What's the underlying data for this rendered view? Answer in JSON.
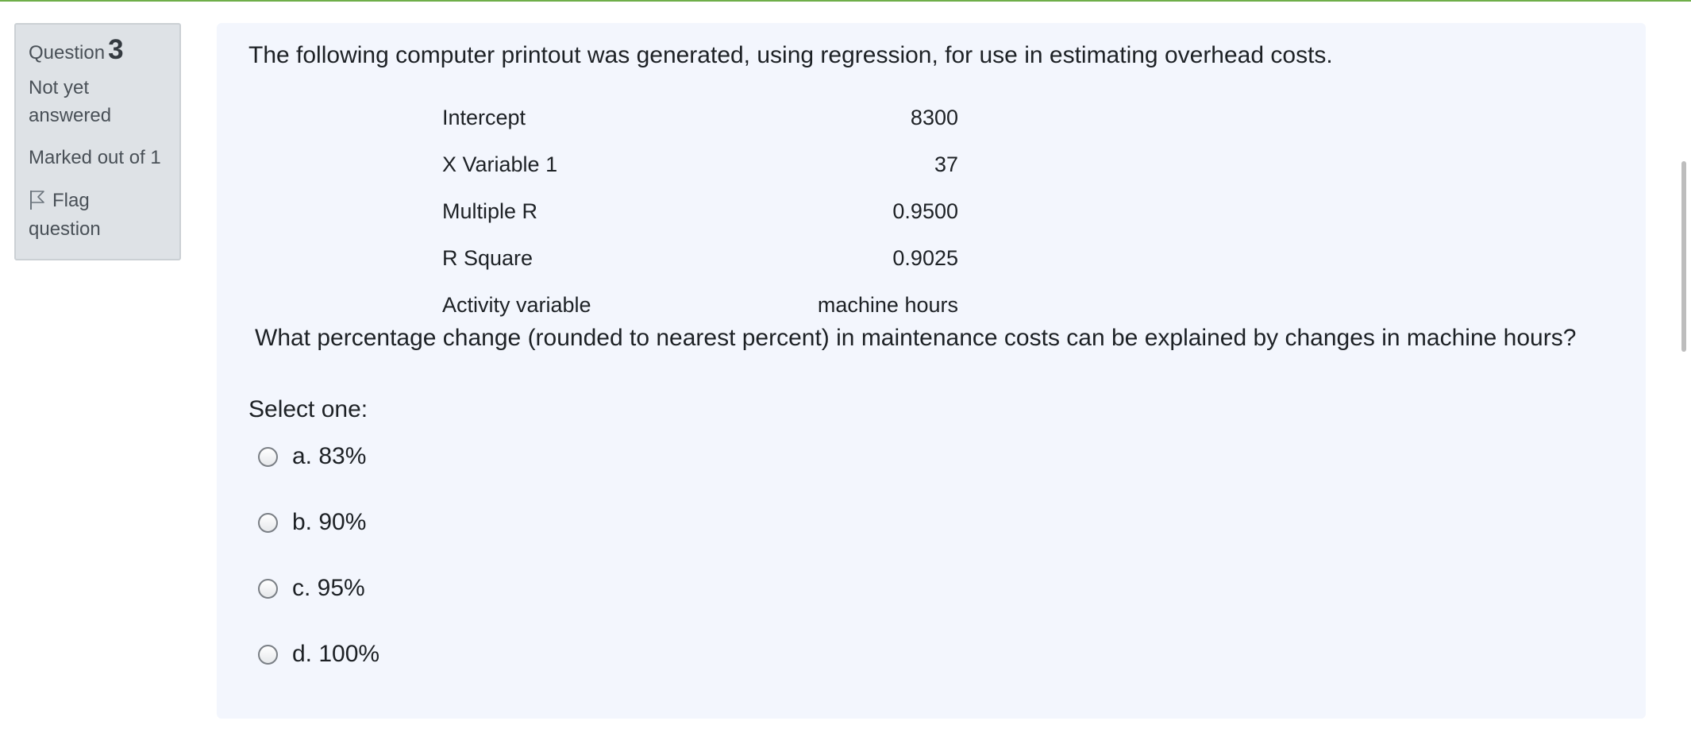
{
  "question_info": {
    "label": "Question",
    "number": "3",
    "state": "Not yet answered",
    "marks": "Marked out of 1",
    "flag_label": "Flag question"
  },
  "question": {
    "intro": "The following computer printout was generated, using regression, for use in estimating overhead costs.",
    "table": [
      {
        "label": "Intercept",
        "value": "8300"
      },
      {
        "label": "X Variable 1",
        "value": "37"
      },
      {
        "label": "Multiple R",
        "value": "0.9500"
      },
      {
        "label": "R Square",
        "value": "0.9025"
      },
      {
        "label": "Activity variable",
        "value": "machine hours"
      }
    ],
    "prompt": "What percentage change (rounded to nearest percent) in maintenance costs can be explained by changes in machine hours?",
    "select_label": "Select one:",
    "options": [
      {
        "label": "a. 83%"
      },
      {
        "label": "b. 90%"
      },
      {
        "label": "c. 95%"
      },
      {
        "label": "d. 100%"
      }
    ]
  },
  "colors": {
    "accent_line": "#6fae49",
    "content_bg": "#f3f6fd",
    "info_bg": "#dee2e6"
  },
  "icons": {
    "flag": "flag-icon"
  }
}
